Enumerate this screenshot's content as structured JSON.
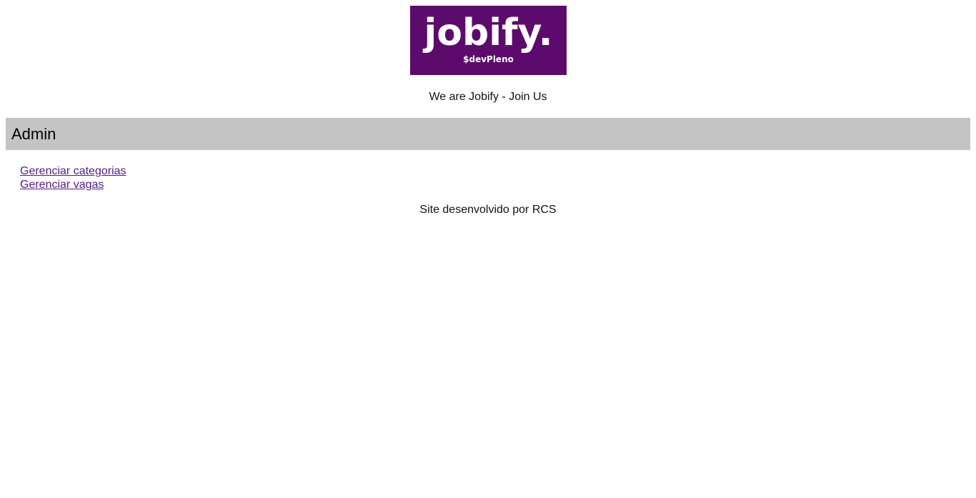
{
  "header": {
    "logo": {
      "wordmark": "jobify.",
      "subtitle": "$devPleno",
      "background_color": "#5c0b6d"
    },
    "tagline": "We are Jobify - Join Us"
  },
  "admin": {
    "title": "Admin",
    "bar_color": "#c4c4c4",
    "links": [
      {
        "label": "Gerenciar categorias"
      },
      {
        "label": "Gerenciar vagas"
      }
    ]
  },
  "footer": {
    "text": "Site desenvolvido por RCS"
  },
  "colors": {
    "link": "#551a8b",
    "text": "#111111"
  }
}
